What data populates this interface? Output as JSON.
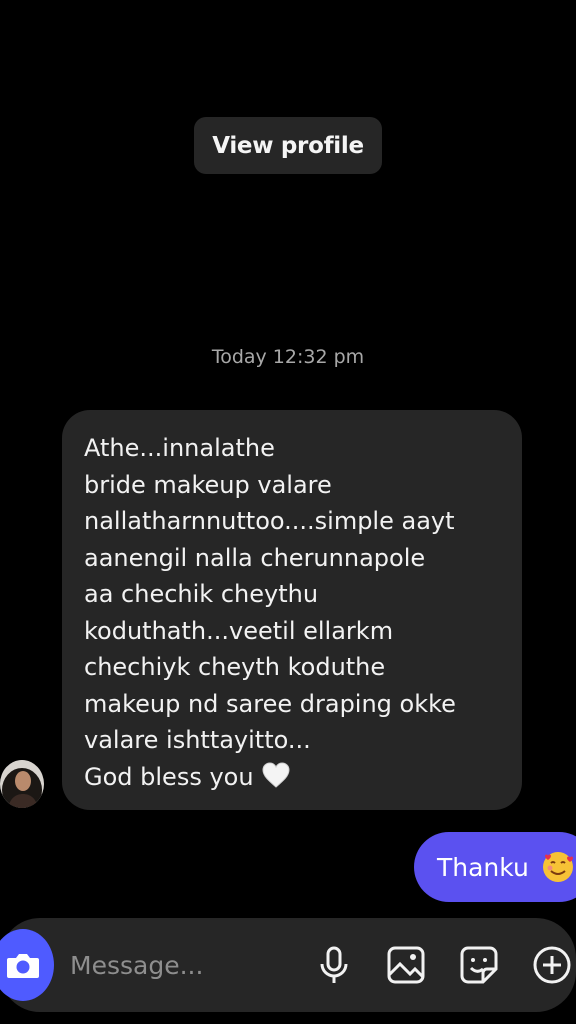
{
  "header": {
    "view_profile_label": "View profile"
  },
  "conversation": {
    "timestamp": "Today 12:32 pm",
    "incoming_lines": [
      "Athe...innalathe",
      "bride makeup valare",
      "nallatharnnuttoo....simple aayt",
      "aanengil nalla cherunnapole",
      "aa chechik cheythu",
      "koduthath...veetil ellarkm",
      "chechiyk cheyth koduthe",
      "makeup nd saree draping okke",
      "valare ishttayitto...",
      "God bless you"
    ],
    "incoming_emoji": "white-heart",
    "outgoing_text": "Thanku",
    "outgoing_emoji": "smiling-face-with-hearts"
  },
  "composer": {
    "placeholder": "Message...",
    "icons": [
      "camera-icon",
      "microphone-icon",
      "gallery-icon",
      "sticker-icon",
      "add-icon"
    ]
  },
  "colors": {
    "background": "#000000",
    "bubble_incoming": "#262626",
    "bubble_outgoing": "#5b51f0",
    "camera_button": "#4f5bff",
    "timestamp_text": "#a8a8a8"
  }
}
